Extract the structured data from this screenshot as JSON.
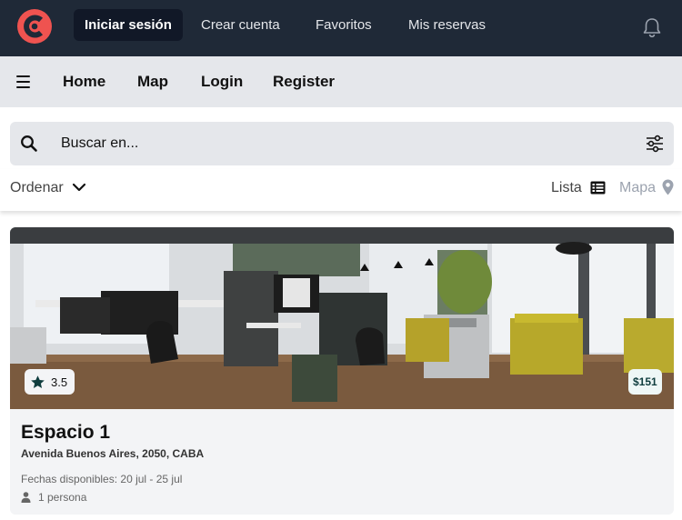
{
  "topbar": {
    "nav": [
      {
        "label": "Iniciar sesión",
        "active": true
      },
      {
        "label": "Crear cuenta",
        "active": false
      },
      {
        "label": "Favoritos",
        "active": false
      },
      {
        "label": "Mis reservas",
        "active": false
      }
    ],
    "logo_color": "#ef5350",
    "bg_color": "#1f2937"
  },
  "subnav": {
    "links": [
      "Home",
      "Map",
      "Login",
      "Register"
    ]
  },
  "search": {
    "placeholder": "Buscar en..."
  },
  "sort": {
    "label": "Ordenar"
  },
  "views": {
    "list_label": "Lista",
    "map_label": "Mapa"
  },
  "card": {
    "rating": "3.5",
    "price": "$151",
    "title": "Espacio 1",
    "address": "Avenida Buenos Aires, 2050, CABA",
    "dates": "Fechas disponibles: 20 jul - 25 jul",
    "people": "1 persona"
  }
}
